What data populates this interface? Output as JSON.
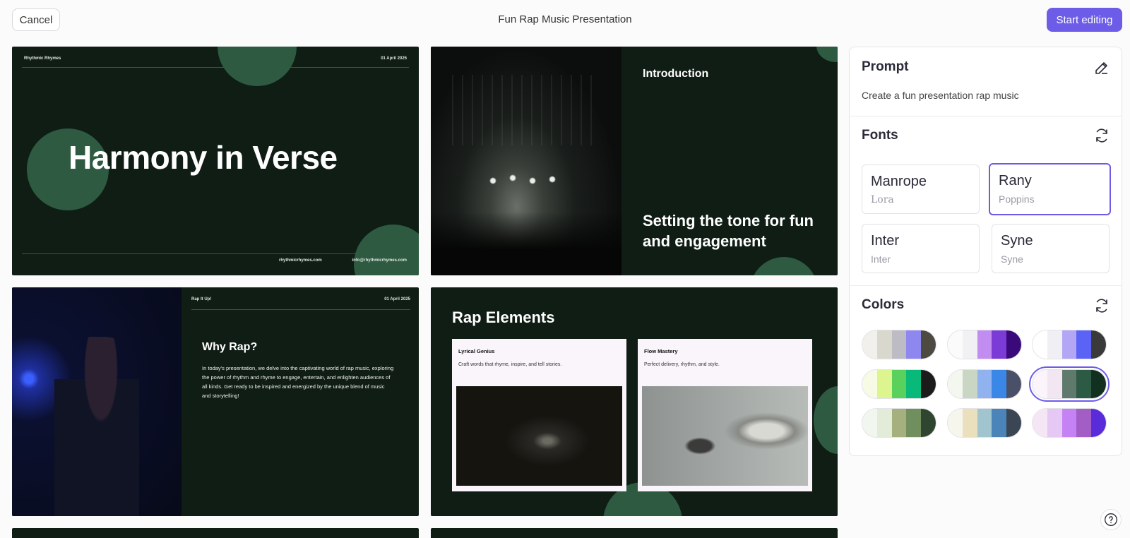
{
  "header": {
    "cancel_label": "Cancel",
    "title": "Fun Rap Music Presentation",
    "start_label": "Start editing"
  },
  "slides": {
    "s1": {
      "brand": "Rhythmic Rhymes",
      "date": "01 April 2025",
      "title": "Harmony in Verse",
      "website": "rhythmicrhymes.com",
      "email": "info@rhythmicrhymes.com"
    },
    "s2": {
      "heading": "Introduction",
      "subheading": "Setting the tone for fun and engagement"
    },
    "s3": {
      "tag": "Rap It Up!",
      "date": "01 April 2025",
      "title": "Why Rap?",
      "body": "In today's presentation, we delve into the captivating world of rap music, exploring the power of rhythm and rhyme to engage, entertain, and enlighten audiences of all kinds. Get ready to be inspired and energized by the unique blend of music and storytelling!"
    },
    "s4": {
      "title": "Rap Elements",
      "cards": [
        {
          "title": "Lyrical Genius",
          "desc": "Craft words that rhyme, inspire, and tell stories."
        },
        {
          "title": "Flow Mastery",
          "desc": "Perfect delivery, rhythm, and style."
        }
      ]
    }
  },
  "panel": {
    "prompt": {
      "title": "Prompt",
      "text": "Create a fun presentation rap music",
      "icon": "pencil-icon"
    },
    "fonts": {
      "title": "Fonts",
      "icon": "refresh-icon",
      "items": [
        {
          "name": "Manrope",
          "sub": "Lora"
        },
        {
          "name": "Rany",
          "sub": "Poppins",
          "selected": true
        },
        {
          "name": "Inter",
          "sub": "Inter"
        },
        {
          "name": "Syne",
          "sub": "Syne"
        }
      ]
    },
    "colors": {
      "title": "Colors",
      "icon": "refresh-icon",
      "palettes": [
        [
          "#f1f0ec",
          "#d9d8cc",
          "#bdbcc4",
          "#8f87f0",
          "#4d4a42"
        ],
        [
          "#fbfbfb",
          "#f1f1f3",
          "#c28df0",
          "#7a3bd6",
          "#3a0a7a"
        ],
        [
          "#ffffff",
          "#f0f0f4",
          "#b3a6f4",
          "#5a63f5",
          "#3a3a3a"
        ],
        [
          "#f7fbe6",
          "#dcf58e",
          "#5ad15d",
          "#09b97a",
          "#1b1b1b"
        ],
        [
          "#f4f6f0",
          "#c9d6c4",
          "#90b3f0",
          "#3b87e8",
          "#4a5068"
        ],
        [
          "#fbf4fa",
          "#f2e6f2",
          "#5f7a6c",
          "#2c5a44",
          "#123020"
        ],
        [
          "#f1f6ee",
          "#e2ecd9",
          "#a6b07e",
          "#718f5e",
          "#2f4530"
        ],
        [
          "#f7f6ec",
          "#ebe0bd",
          "#a0c5cf",
          "#4a84b8",
          "#3a4654"
        ],
        [
          "#f4e6f4",
          "#e6c8f4",
          "#c482f5",
          "#a35ec5",
          "#5a2bd8"
        ]
      ]
    }
  }
}
